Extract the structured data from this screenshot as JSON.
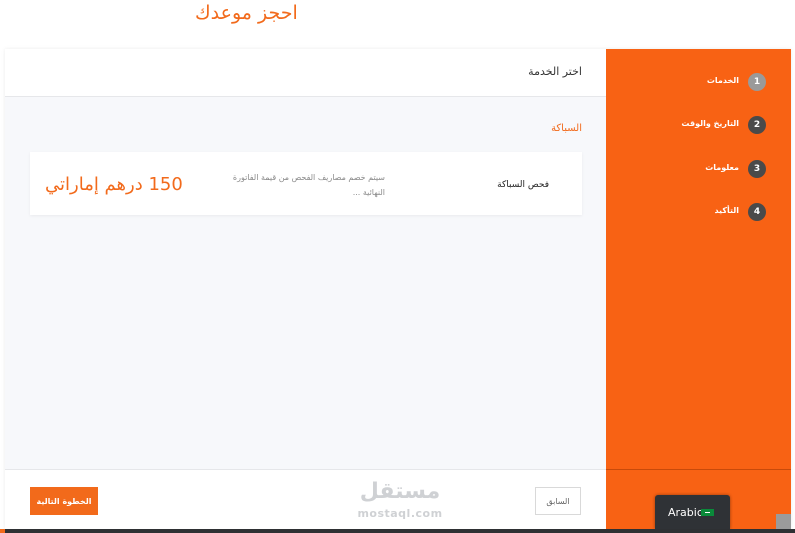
{
  "page": {
    "title": "احجز موعدك"
  },
  "main": {
    "header_title": "اختر الخدمة",
    "category": "السباكة",
    "service": {
      "name": "فحص السباكة",
      "description": "سيتم خصم مصاريف الفحص من قيمة الفاتورة النهائية ...",
      "price": "150 درهم إماراتي"
    }
  },
  "steps": [
    {
      "number": "1",
      "label": "الخدمات"
    },
    {
      "number": "2",
      "label": "التاريخ والوقت"
    },
    {
      "number": "3",
      "label": "معلومات"
    },
    {
      "number": "4",
      "label": "التأكيد"
    }
  ],
  "footer": {
    "next_label": "الخطوة التالية",
    "prev_label": "السابق"
  },
  "watermark": {
    "arabic": "مستقل",
    "latin": "mostaql.com"
  },
  "language": {
    "label": "Arabic",
    "flag": "uae-flag-icon"
  },
  "colors": {
    "accent": "#f26a1b",
    "sidebar": "#f86214",
    "step_inactive": "#4a4a4a",
    "step_active": "#9a9a9a"
  }
}
